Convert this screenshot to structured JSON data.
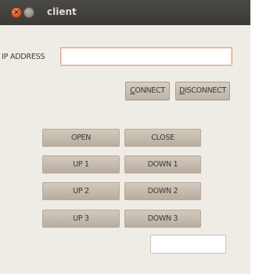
{
  "window": {
    "title": "client"
  },
  "connection": {
    "ip_label": "IP ADDRESS",
    "ip_value": "",
    "connect_label": "CONNECT",
    "connect_mnemonic": "C",
    "connect_rest": "ONNECT",
    "disconnect_label": "DISCONNECT",
    "disconnect_mnemonic": "D",
    "disconnect_rest": "ISCONNECT"
  },
  "controls": {
    "open": "OPEN",
    "close": "CLOSE",
    "up1": "UP 1",
    "down1": "DOWN 1",
    "up2": "UP 2",
    "down2": "DOWN 2",
    "up3": "UP 3",
    "down3": "DOWN 3"
  },
  "status": {
    "value": ""
  },
  "colors": {
    "titlebar": "#3b3a36",
    "window_bg": "#efebe5",
    "button": "#c8bfb2",
    "focus_border": "#e9a38b"
  },
  "icons": {
    "close": "close-icon",
    "minimize": "minimize-icon"
  }
}
